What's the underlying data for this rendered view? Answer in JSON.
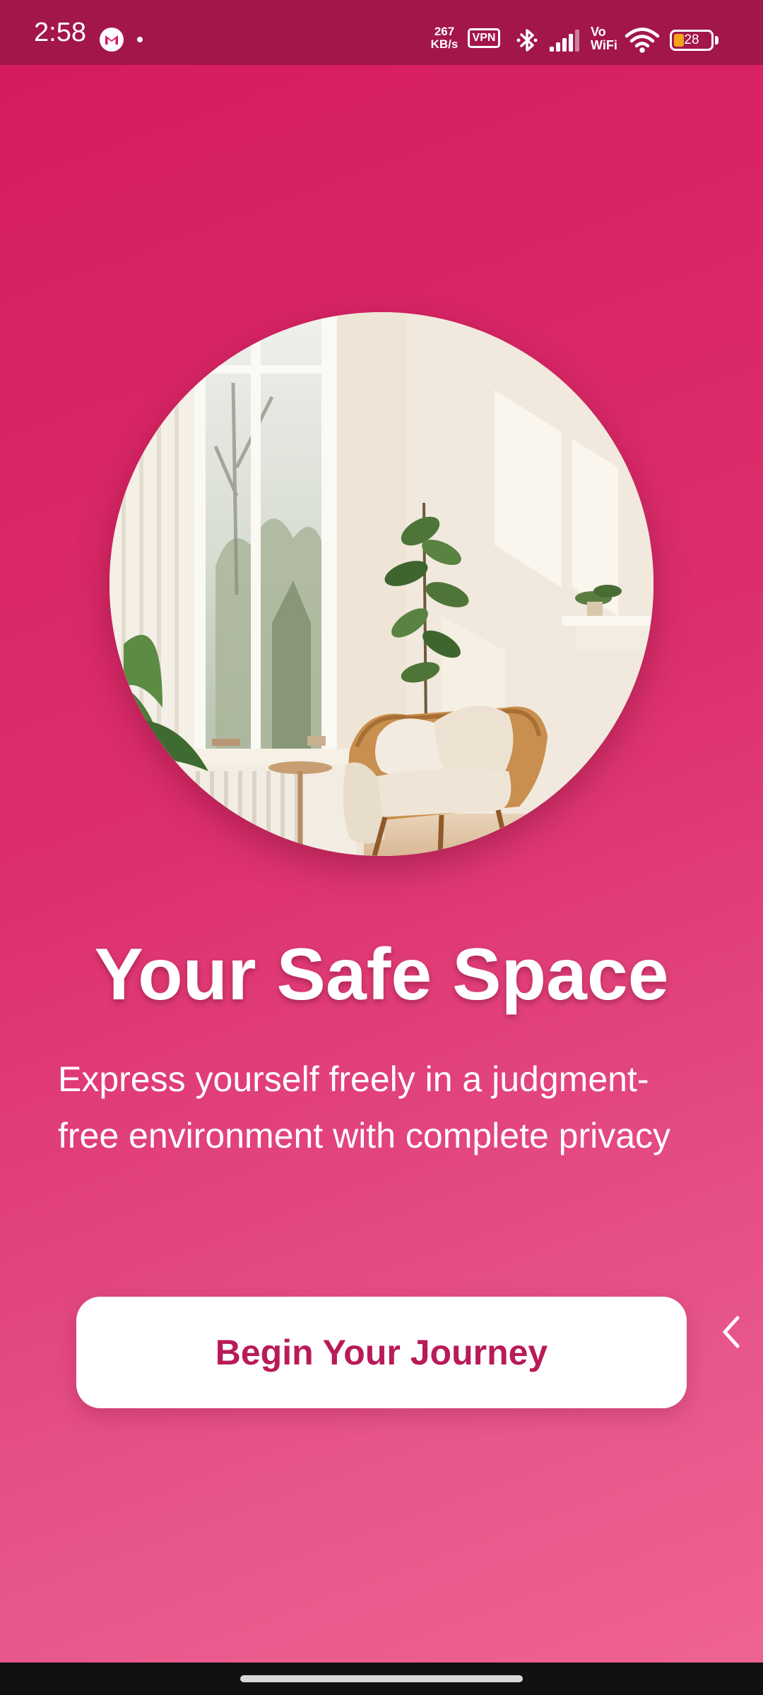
{
  "status_bar": {
    "time": "2:58",
    "net_speed_value": "267",
    "net_speed_unit": "KB/s",
    "vpn_label": "VPN",
    "vowifi_top": "Vo",
    "vowifi_bottom": "WiFi",
    "battery_level": "28",
    "battery_fraction": 0.28,
    "icons": [
      "gmail-icon",
      "bluetooth-icon",
      "signal-icon",
      "wifi-icon",
      "battery-icon"
    ]
  },
  "onboarding": {
    "title": "Your Safe Space",
    "subtitle": "Express yourself freely in a judgment-free environment with complete privacy",
    "cta_label": "Begin Your Journey"
  },
  "colors": {
    "background_top": "#d51a5e",
    "background_bottom": "#ef6493",
    "status_bar": "#a3164c",
    "button_bg": "#ffffff",
    "button_text": "#b81b58"
  }
}
